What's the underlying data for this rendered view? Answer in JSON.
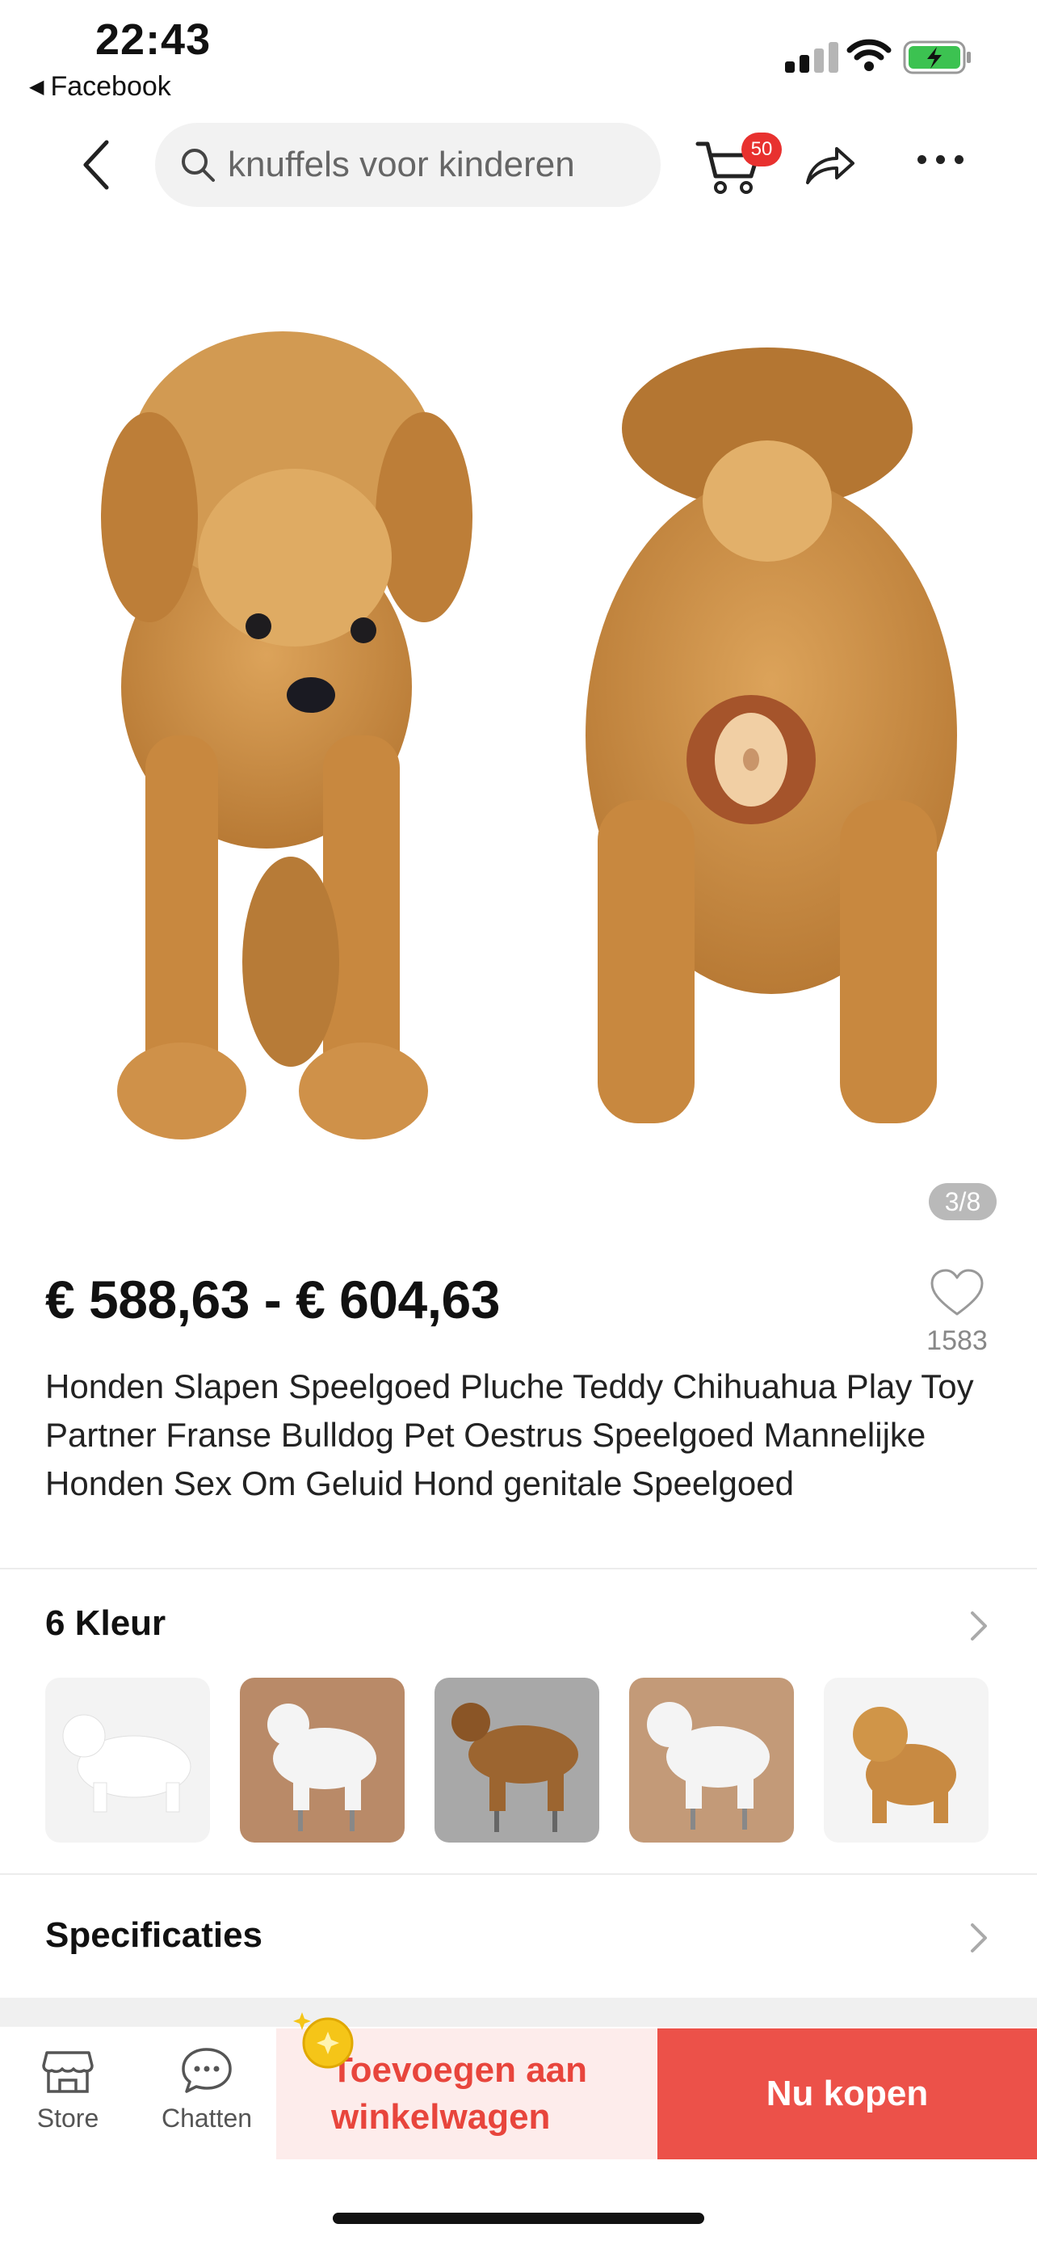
{
  "status": {
    "time": "22:43",
    "back_app": "Facebook"
  },
  "search": {
    "query": "knuffels voor kinderen"
  },
  "cart": {
    "badge": "50"
  },
  "gallery": {
    "page_indicator": "3/8"
  },
  "product": {
    "price": "€ 588,63 - € 604,63",
    "likes": "1583",
    "title": "Honden Slapen Speelgoed Pluche Teddy Chihuahua Play Toy Partner Franse Bulldog Pet Oestrus Speelgoed Mannelijke Honden Sex Om Geluid Hond genitale Speelgoed"
  },
  "colors": {
    "heading": "6 Kleur"
  },
  "specs": {
    "heading": "Specificaties"
  },
  "bottom": {
    "store_label": "Store",
    "chat_label": "Chatten",
    "add_to_cart_line1": "Toevoegen aan",
    "add_to_cart_line2": "winkelwagen",
    "buy_now": "Nu kopen"
  },
  "theme": {
    "accent": "#ec5149",
    "badge": "#e8312f",
    "toy_brown": "#c88a42"
  }
}
